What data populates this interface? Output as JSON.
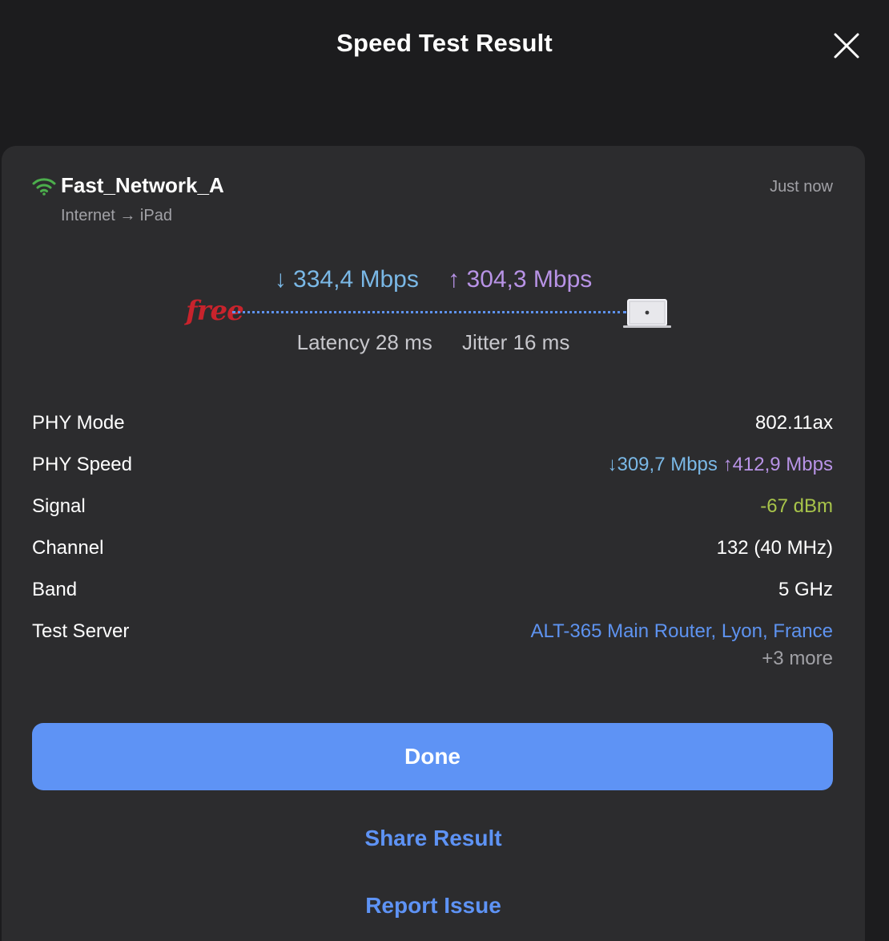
{
  "header": {
    "title": "Speed Test Result",
    "close_icon": "close-icon"
  },
  "network": {
    "name": "Fast_Network_A",
    "path": "Internet → iPad",
    "timestamp": "Just now",
    "icon": "wifi-icon",
    "icon_color": "#4cae4c"
  },
  "result": {
    "download": "↓ 334,4 Mbps",
    "upload": "↑ 304,3 Mbps",
    "isp_logo": "free",
    "device_icon": "laptop-icon",
    "latency": "Latency 28 ms",
    "jitter": "Jitter 16 ms"
  },
  "details": {
    "phy_mode_label": "PHY Mode",
    "phy_mode_value": "802.11ax",
    "phy_speed_label": "PHY Speed",
    "phy_speed_down": "↓309,7 Mbps",
    "phy_speed_up": "↑412,9 Mbps",
    "signal_label": "Signal",
    "signal_value": "-67 dBm",
    "channel_label": "Channel",
    "channel_value": "132 (40 MHz)",
    "band_label": "Band",
    "band_value": "5 GHz",
    "server_label": "Test Server",
    "server_value": "ALT-365 Main Router, Lyon, France",
    "server_more": "+3 more"
  },
  "actions": {
    "done": "Done",
    "share": "Share Result",
    "report": "Report Issue"
  },
  "colors": {
    "background": "#1c1c1e",
    "card": "#2c2c2e",
    "accent": "#5e93f5",
    "download": "#7ab8e6",
    "upload": "#b893e6",
    "signal": "#a8c44a",
    "isp_logo": "#c8232c"
  }
}
